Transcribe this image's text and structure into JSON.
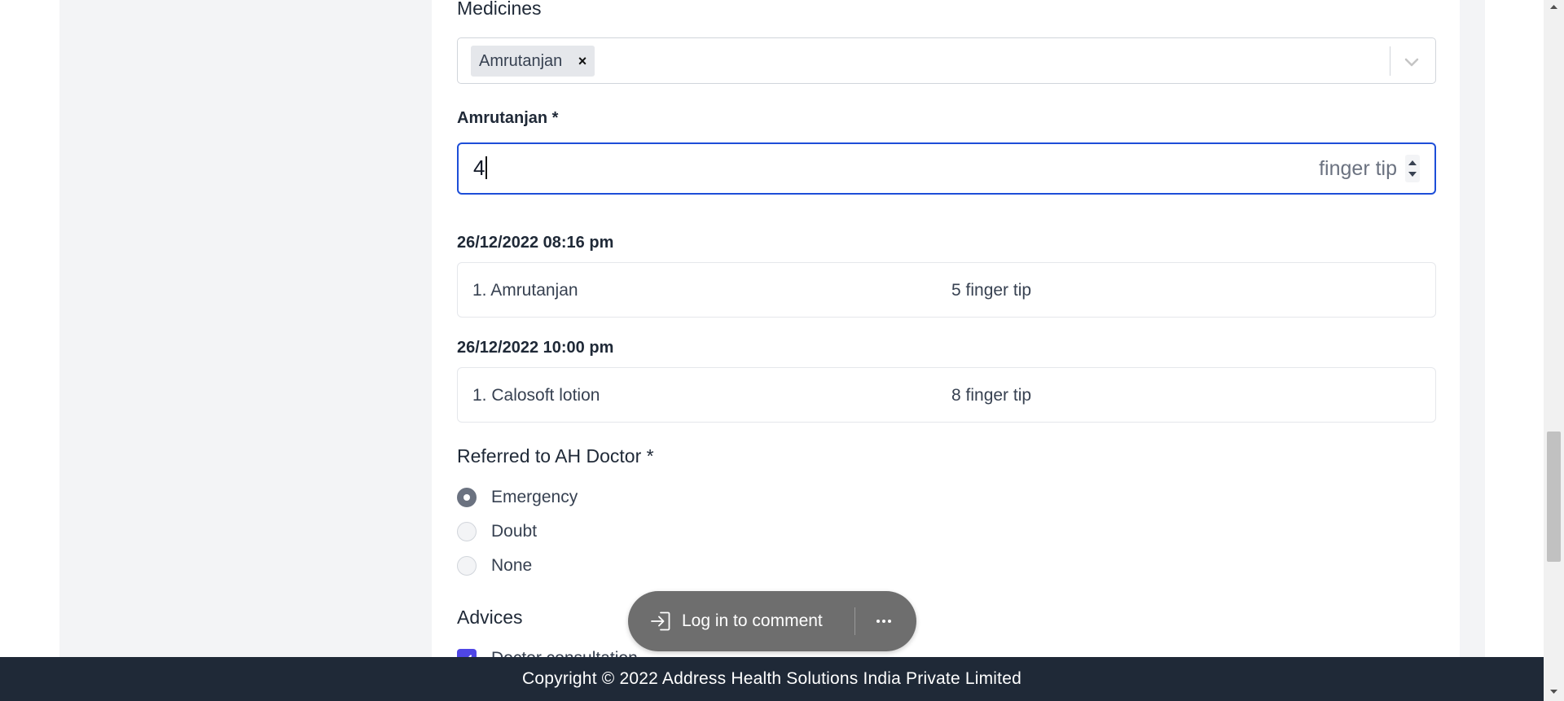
{
  "form": {
    "medicines_heading": "Medicines",
    "medicines_selected": [
      {
        "label": "Amrutanjan",
        "remove": "×"
      }
    ],
    "dose_label": "Amrutanjan *",
    "dose_value": "4",
    "dose_unit": "finger tip"
  },
  "history": [
    {
      "timestamp": "26/12/2022 08:16 pm",
      "item": "1. Amrutanjan",
      "dose": "5 finger tip"
    },
    {
      "timestamp": "26/12/2022 10:00 pm",
      "item": "1. Calosoft lotion",
      "dose": "8 finger tip"
    }
  ],
  "referral": {
    "heading": "Referred to AH Doctor *",
    "options": [
      {
        "label": "Emergency",
        "checked": true
      },
      {
        "label": "Doubt",
        "checked": false
      },
      {
        "label": "None",
        "checked": false
      }
    ]
  },
  "advices": {
    "heading": "Advices",
    "first_option": {
      "label": "Doctor consultation",
      "checked": true
    }
  },
  "toast": {
    "login_label": "Log in to comment",
    "more_icon": "ellipsis-icon"
  },
  "footer": {
    "copyright": "Copyright © 2022 Address Health Solutions India Private Limited"
  },
  "colors": {
    "accent": "#1d4ed8",
    "checkbox": "#4f46e5",
    "footer_bg": "#1f2937",
    "toast_bg": "#6e6e6e"
  }
}
